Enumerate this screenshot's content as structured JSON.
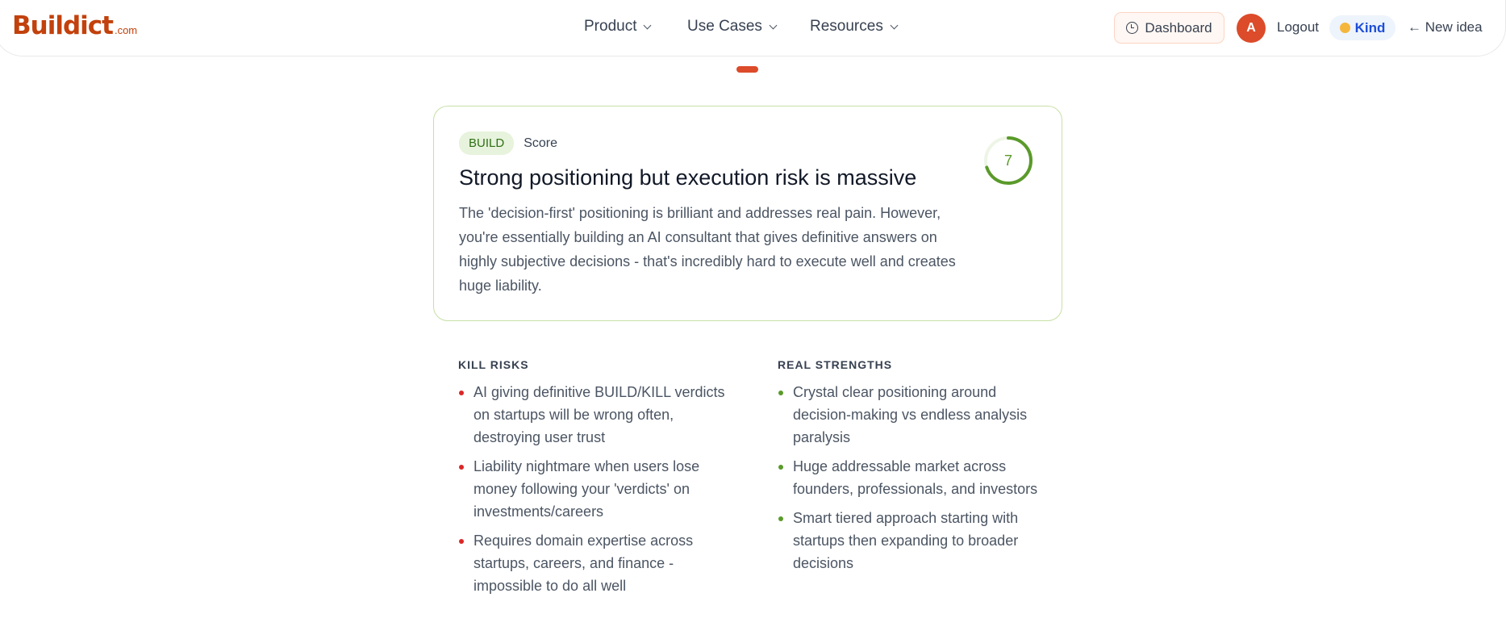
{
  "brand": {
    "logo_main": "Buildict",
    "logo_suffix": ".com"
  },
  "nav": {
    "items": [
      {
        "label": "Product"
      },
      {
        "label": "Use Cases"
      },
      {
        "label": "Resources"
      }
    ]
  },
  "header_actions": {
    "dashboard_label": "Dashboard",
    "avatar_initial": "A",
    "logout_label": "Logout",
    "mode_badge_label": "Kind",
    "new_idea_label": "← New idea"
  },
  "verdict": {
    "badge": "BUILD",
    "score_label": "Score",
    "score": "7",
    "score_max": 10,
    "title": "Strong positioning but execution risk is massive",
    "description": "The 'decision-first' positioning is brilliant and addresses real pain. However, you're essentially building an AI consultant that gives definitive answers on highly subjective decisions - that's incredibly hard to execute well and creates huge liability."
  },
  "kill_risks": {
    "heading": "KILL RISKS",
    "items": [
      "AI giving definitive BUILD/KILL verdicts on startups will be wrong often, destroying user trust",
      "Liability nightmare when users lose money following your 'verdicts' on investments/careers",
      "Requires domain expertise across startups, careers, and finance - impossible to do all well"
    ]
  },
  "real_strengths": {
    "heading": "REAL STRENGTHS",
    "items": [
      "Crystal clear positioning around decision-making vs endless analysis paralysis",
      "Huge addressable market across founders, professionals, and investors",
      "Smart tiered approach starting with startups then expanding to broader decisions"
    ]
  },
  "colors": {
    "brand": "#c2410c",
    "accent": "#dc4b2a",
    "build_green": "#5a9a2a",
    "risk_red": "#dc2626"
  }
}
